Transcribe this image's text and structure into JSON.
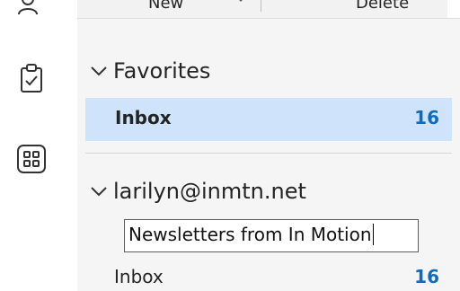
{
  "toolbar": {
    "new_label": "New",
    "delete_label": "Delete"
  },
  "rail": {
    "icons": [
      "people-icon",
      "tasks-icon",
      "apps-icon"
    ]
  },
  "favorites": {
    "header": "Favorites",
    "inbox_label": "Inbox",
    "inbox_count": "16"
  },
  "account": {
    "email": "larilyn@inmtn.net",
    "rename_value": "Newsletters from In Motion",
    "inbox_label": "Inbox",
    "inbox_count": "16"
  },
  "colors": {
    "accent": "#0f6cbd",
    "selected_bg": "#cfe4fa",
    "pane_bg": "#f5f5f5"
  }
}
